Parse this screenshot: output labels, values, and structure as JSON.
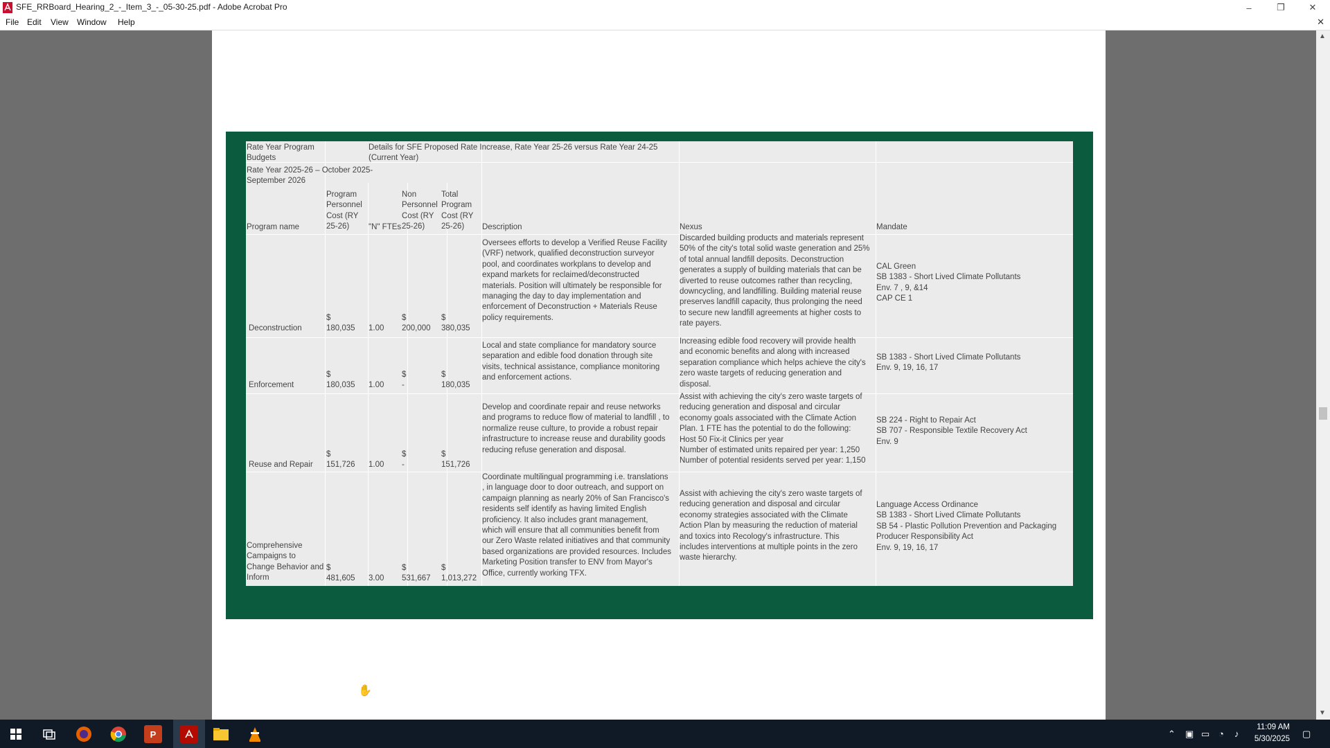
{
  "window": {
    "title": "SFE_RRBoard_Hearing_2_-_Item_3_-_05-30-25.pdf - Adobe Acrobat Pro"
  },
  "menu": [
    "File",
    "Edit",
    "View",
    "Window",
    "Help"
  ],
  "table": {
    "header1_a": "Rate Year Program\nBudgets",
    "header1_b": "Details for SFE Proposed Rate Increase, Rate Year 25-26 versus Rate Year 24-25\n(Current Year)",
    "header2": "Rate Year 2025-26 – October 2025-\nSeptember 2026",
    "columns": {
      "program_name": "Program name",
      "personnel_cost": "Program\nPersonnel\nCost (RY\n25-26)",
      "fte": "\"N\" FTEs",
      "non_personnel": "Non\nPersonnel\nCost (RY\n25-26)",
      "total": "Total\nProgram\nCost (RY\n25-26)",
      "description": "Description",
      "nexus": "Nexus",
      "mandate": "Mandate"
    },
    "rows": [
      {
        "name": "Deconstruction",
        "personnel": "$\n180,035",
        "fte": "1.00",
        "non_personnel": "$\n200,000",
        "total": "$\n380,035",
        "description": "Oversees efforts to develop a Verified Reuse Facility\n(VRF) network, qualified deconstruction surveyor\npool, and coordinates workplans to develop and\nexpand markets for reclaimed/deconstructed\nmaterials. Position will ultimately be responsible for\nmanaging the day to day implementation and\nenforcement of Deconstruction + Materials Reuse\npolicy requirements.",
        "nexus": "Discarded building products and materials represent\n50% of the city's total solid waste generation and 25%\nof total annual landfill deposits. Deconstruction\ngenerates a supply of building materials that can be\ndiverted to reuse outcomes rather than recycling,\ndowncycling, and landfilling. Building material reuse\npreserves landfill capacity, thus prolonging the need\nto secure new landfill agreements at higher costs to\nrate payers.",
        "mandate": "CAL Green\nSB 1383 - Short Lived Climate Pollutants\nEnv. 7 , 9, &14\nCAP CE 1"
      },
      {
        "name": "Enforcement",
        "personnel": "$\n180,035",
        "fte": "1.00",
        "non_personnel": "$\n-",
        "total": "$\n180,035",
        "description": "Local and state compliance for mandatory source\nseparation and edible food donation through  site\nvisits, technical assistance, compliance monitoring\nand enforcement actions.",
        "nexus": "Increasing edible food recovery will provide health\nand economic benefits and along with increased\nseparation compliance which helps achieve the city's\nzero waste targets of reducing generation and\ndisposal.",
        "mandate": "SB 1383 - Short Lived Climate Pollutants\nEnv. 9, 19, 16, 17"
      },
      {
        "name": "Reuse and Repair",
        "personnel": "$\n151,726",
        "fte": "1.00",
        "non_personnel": "$\n-",
        "total": "$\n151,726",
        "description": "Develop and coordinate repair and reuse networks\nand programs to reduce flow of material to landfill , to\nnormalize reuse culture, to provide a robust repair\ninfrastructure to increase reuse and durability goods\nreducing refuse generation and disposal.",
        "nexus": "Assist with achieving the city's zero waste targets of\nreducing generation and disposal and circular\neconomy goals associated with the Climate Action\nPlan. 1 FTE has the potential to do the following:\nHost 50 Fix-it Clinics per year\nNumber of estimated units repaired per year: 1,250\nNumber of potential residents served per year: 1,150",
        "mandate": "SB 224 - Right to Repair Act\nSB 707 - Responsible Textile Recovery Act\nEnv. 9"
      },
      {
        "name": "Comprehensive\nCampaigns to\nChange Behavior and\nInform",
        "personnel": "$\n481,605",
        "fte": "3.00",
        "non_personnel": "$\n531,667",
        "total": "$\n1,013,272",
        "description": "Coordinate multilingual programming i.e. translations\n, in language door to door outreach, and support on\ncampaign planning  as nearly 20% of San Francisco's\nresidents self identify as having limited English\nproficiency. It also includes grant management,\nwhich will ensure that all communities benefit from\nour Zero Waste related initiatives and that community\nbased organizations are provided resources. Includes\nMarketing Position transfer to ENV from Mayor's\nOffice, currently working TFX.",
        "nexus": "Assist with achieving the city's zero waste targets of\nreducing generation and disposal and circular\neconomy strategies associated with the Climate\nAction Plan by measuring the reduction of material\nand toxics into Recology's infrastructure. This\nincludes interventions at multiple points in the zero\nwaste hierarchy.",
        "mandate": "Language Access Ordinance\nSB 1383 - Short Lived Climate Pollutants\nSB 54 - Plastic Pollution Prevention and Packaging\nProducer Responsibility Act\nEnv. 9, 19, 16, 17"
      }
    ]
  },
  "taskbar": {
    "time": "11:09 AM",
    "date": "5/30/2025"
  }
}
